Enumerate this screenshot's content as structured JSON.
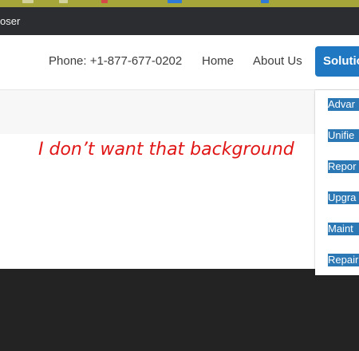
{
  "toolbar": {
    "label": "oser"
  },
  "header": {
    "phone": "Phone: +1-877-677-0202",
    "nav": {
      "home": "Home",
      "about": "About Us",
      "solutions": "Solutio"
    }
  },
  "annotation": {
    "text": "I don’t want that background"
  },
  "dropdown": {
    "items": [
      "Advar",
      "Unifie",
      "Repor",
      "Upgra",
      "Maint",
      "Repair"
    ]
  },
  "colors": {
    "accent": "#1f78c1",
    "highlight": "#2c78b5",
    "annotation": "#e01616",
    "footer": "#232323",
    "toolbar": "#2b2d30"
  }
}
